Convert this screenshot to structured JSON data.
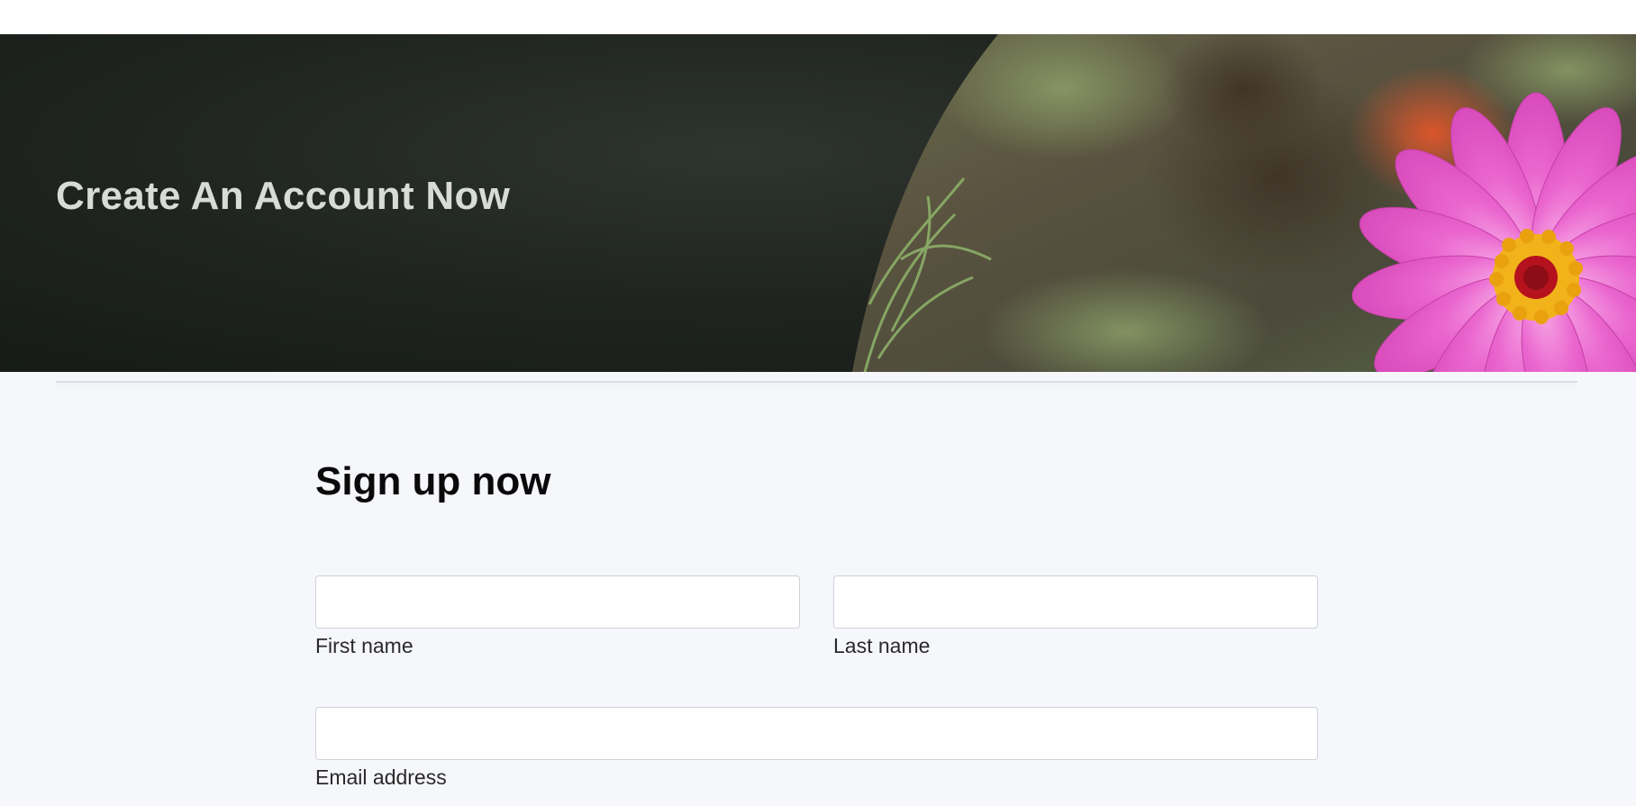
{
  "hero": {
    "title": "Create An Account Now",
    "image": "pink-zinnia-flower-photo",
    "bg_color": "#1b201c"
  },
  "form": {
    "title": "Sign up now",
    "fields": [
      {
        "label": "First name",
        "value": "",
        "placeholder": ""
      },
      {
        "label": "Last name",
        "value": "",
        "placeholder": ""
      },
      {
        "label": "Email address",
        "value": "",
        "placeholder": ""
      }
    ]
  },
  "colors": {
    "page_bg": "#f6f7fb",
    "hero_title": "#d9dcd6",
    "flower_pink": "#e85fc8",
    "flower_center": "#f2b21a"
  }
}
